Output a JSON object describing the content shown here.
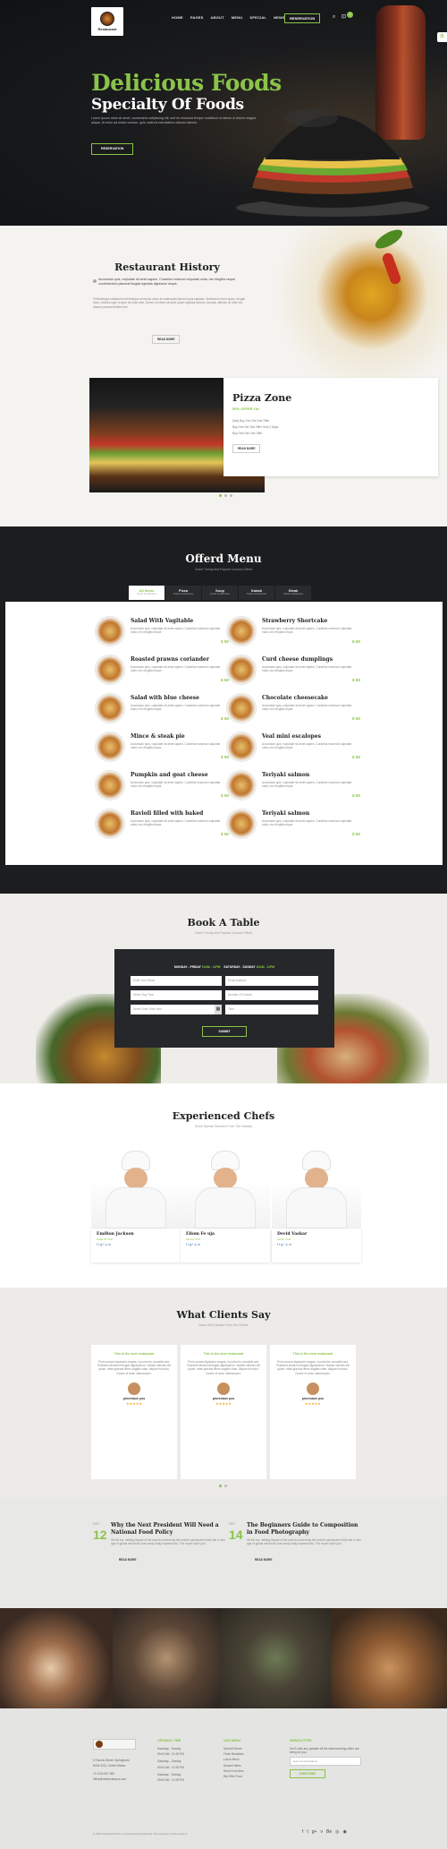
{
  "nav": {
    "logo_text": "Restaurant",
    "items": [
      "HOME",
      "PAGES",
      "ABOUT",
      "MENU",
      "SPECIAL",
      "NEWS"
    ],
    "reservation": "RESERVATION",
    "cart_count": "0"
  },
  "hero": {
    "title": "Delicious Foods",
    "subtitle": "Specialty Of Foods",
    "text": "Lorem ipsum dolor sit amet, consectetur adipiscing elit, sed do eiusmod tempor incididunt ut labore et dolore magna aliqua. Ut enim ad minim veniam, quis nostrud exercitation ullamco laboris.",
    "button": "RESERVATION"
  },
  "history": {
    "title": "Restaurant History",
    "quote": "Accumsan quis, vulputate sit amet sapien. Curabitur euismod vulputate nulla, nec fringilla neque condimentum placerat feugiat egestas dignissim neque.",
    "text": "Pellentesque habitant morbi tristique senectus netus et malesuada fames turpis egestas. Vestibulum tortor quam, feugiat vitae, ultricies eget, tempor sit amet ante. Donec eu libero sit amet quam egestas semper. Aenean ultricies mi vitae est. Mauris placerat eleifend leo.",
    "readmore": "READ MORE",
    "pizza": {
      "title": "Pizza Zone",
      "offer": "50% OFFER ON",
      "lines": [
        "Daily Buy One Get One Offer",
        "Buy One Get Two Offer Only 2 Days",
        "Buy One Get One Offer"
      ],
      "readmore": "READ MORE"
    }
  },
  "menu": {
    "title": "Offerd Menu",
    "subtitle": "Some Trendy And Popular Courses Offerd",
    "tabs": [
      {
        "label": "All Items",
        "sub": "Fresh & Delicious"
      },
      {
        "label": "Pizza",
        "sub": "Fresh & Delicious"
      },
      {
        "label": "Soup",
        "sub": "Fresh & Delicious"
      },
      {
        "label": "Kabab",
        "sub": "Fresh & Delicious"
      },
      {
        "label": "Steak",
        "sub": "Fresh & Delicious"
      }
    ],
    "items": [
      {
        "name": "Salad With Vagitable",
        "desc": "Accumsan quis, vulputate sit amet sapien. Curabitur euismod vulputate nulla, nec fringilla neque.",
        "price": "$ 50"
      },
      {
        "name": "Strawberry Shortcake",
        "desc": "Accumsan quis, vulputate sit amet sapien. Curabitur euismod vulputate nulla, nec fringilla neque.",
        "price": "$ 50"
      },
      {
        "name": "Roasted prawns coriander",
        "desc": "Accumsan quis, vulputate sit amet sapien. Curabitur euismod vulputate nulla, nec fringilla neque.",
        "price": "$ 50"
      },
      {
        "name": "Curd cheese dumplings",
        "desc": "Accumsan quis, vulputate sit amet sapien. Curabitur euismod vulputate nulla, nec fringilla neque.",
        "price": "$ 50"
      },
      {
        "name": "Salad with blue cheese",
        "desc": "Accumsan quis, vulputate sit amet sapien. Curabitur euismod vulputate nulla, nec fringilla neque.",
        "price": "$ 50"
      },
      {
        "name": "Chocolate cheesecake",
        "desc": "Accumsan quis, vulputate sit amet sapien. Curabitur euismod vulputate nulla, nec fringilla neque.",
        "price": "$ 50"
      },
      {
        "name": "Mince & steak pie",
        "desc": "Accumsan quis, vulputate sit amet sapien. Curabitur euismod vulputate nulla, nec fringilla neque.",
        "price": "$ 50"
      },
      {
        "name": "Veal mini escalopes",
        "desc": "Accumsan quis, vulputate sit amet sapien. Curabitur euismod vulputate nulla, nec fringilla neque.",
        "price": "$ 50"
      },
      {
        "name": "Pumpkin and goat cheese",
        "desc": "Accumsan quis, vulputate sit amet sapien. Curabitur euismod vulputate nulla, nec fringilla neque.",
        "price": "$ 50"
      },
      {
        "name": "Teriyaki salmon",
        "desc": "Accumsan quis, vulputate sit amet sapien. Curabitur euismod vulputate nulla, nec fringilla neque.",
        "price": "$ 50"
      },
      {
        "name": "Ravioli filled with baked",
        "desc": "Accumsan quis, vulputate sit amet sapien. Curabitur euismod vulputate nulla, nec fringilla neque.",
        "price": "$ 50"
      },
      {
        "name": "Teriyaki salmon",
        "desc": "Accumsan quis, vulputate sit amet sapien. Curabitur euismod vulputate nulla, nec fringilla neque.",
        "price": "$ 50"
      }
    ]
  },
  "booking": {
    "title": "Book A Table",
    "subtitle": "Some Trendy And Popular Courses Offerd",
    "hours1": "MONDAY - FRIDAY",
    "time1": "10AM - 11PM",
    "hours2": "SATURDAY - SUNDAY",
    "time2": "10AM - 11PM",
    "fields": [
      "Enter Your Name",
      "Email Address",
      "Select Day Time",
      "Number Of Guests",
      "Select Date Time Here",
      "Time"
    ],
    "submit": "SUBMIT"
  },
  "chefs": {
    "title": "Experienced Chefs",
    "subtitle": "Some Special Teachers From The Industry",
    "list": [
      {
        "name": "Emilion Jackson",
        "role": "Head Of Chef"
      },
      {
        "name": "Eliom Fe uja",
        "role": "Senior Chef"
      },
      {
        "name": "Devid Vaskar",
        "role": "Junior Chef"
      }
    ]
  },
  "testimonials": {
    "title": "What Clients Say",
    "subtitle": "Some Kind Quotes From Our Clients",
    "list": [
      {
        "heading": "This is the best restaurant",
        "text": "Proin ornare dignissim magna, in porta leo convallis sed. Praesent tincidunt feugiat dignissimos. Nullam ultricies elit quam, vitae gravida libero sagittis vitae. Aliquet rhoncus. Donec et dolor ullamcorper.",
        "name": "pinventure pos",
        "stars": "★★★★★"
      },
      {
        "heading": "This is the best restaurant",
        "text": "Proin ornare dignissim magna, in porta leo convallis sed. Praesent tincidunt feugiat dignissimos. Nullam ultricies elit quam, vitae gravida libero sagittis vitae. Aliquet rhoncus. Donec et dolor ullamcorper.",
        "name": "pinventure pos",
        "stars": "★★★★★"
      },
      {
        "heading": "This is the best restaurant",
        "text": "Proin ornare dignissim magna, in porta leo convallis sed. Praesent tincidunt feugiat dignissimos. Nullam ultricies elit quam, vitae gravida libero sagittis vitae. Aliquet rhoncus. Donec et dolor ullamcorper.",
        "name": "pinventure pos",
        "stars": "★★★★★"
      }
    ]
  },
  "blog": [
    {
      "month": "NOV",
      "day": "12",
      "title": "Why the Next President Will Need a National Food Policy",
      "text": "Hit the fuz. striking impact of the launch concerning the world's permanent entry into a new age of global electronic was rarely really experienced. The report didn't just",
      "readmore": "READ MORE"
    },
    {
      "month": "DEC",
      "day": "14",
      "title": "The Beginners Guide to Composition in Food Photography",
      "text": "Hit the fuz. striking impact of the launch concerning the world's permanent entry into a new age of global electronic was rarely really experienced. The report didn't just",
      "readmore": "READ MORE"
    }
  ],
  "footer": {
    "address": [
      "6 Francis Street, Springhurst",
      "NSW 2021, United States"
    ],
    "phone": "+0 1234 567 890",
    "email": "office@restaurantpos.com",
    "opening_title": "OPENING TIME",
    "opening": [
      "Saturday - Sunday",
      "09:00 AM - 01:00 PM",
      "Saturday - Sunday",
      "09:00 AM - 01:00 PM",
      "Saturday - Sunday",
      "09:00 AM - 01:00 PM"
    ],
    "our_menu_title": "OUR MENU",
    "our_menu": [
      "Special Dinner",
      "Fresh Breakfast",
      "Lunch Menu",
      "Dessert Items",
      "Drink Food Item",
      "We Offer Food"
    ],
    "newsletter_title": "NEWSLETTER",
    "newsletter_text": "Don't miss any updates all the sales/ordering offers are being for you.",
    "newsletter_placeholder": "Enter Email Address",
    "subscribe": "SUBSCRIBE",
    "copyright": "© 2017 Restaurant Pos is powered by Restaurant. The property of their owners.",
    "social": [
      "f",
      "t",
      "g+",
      "v",
      "Be",
      "◎",
      "◉"
    ]
  },
  "colors": {
    "accent": "#8bc34a",
    "dark": "#1c1d1f"
  }
}
